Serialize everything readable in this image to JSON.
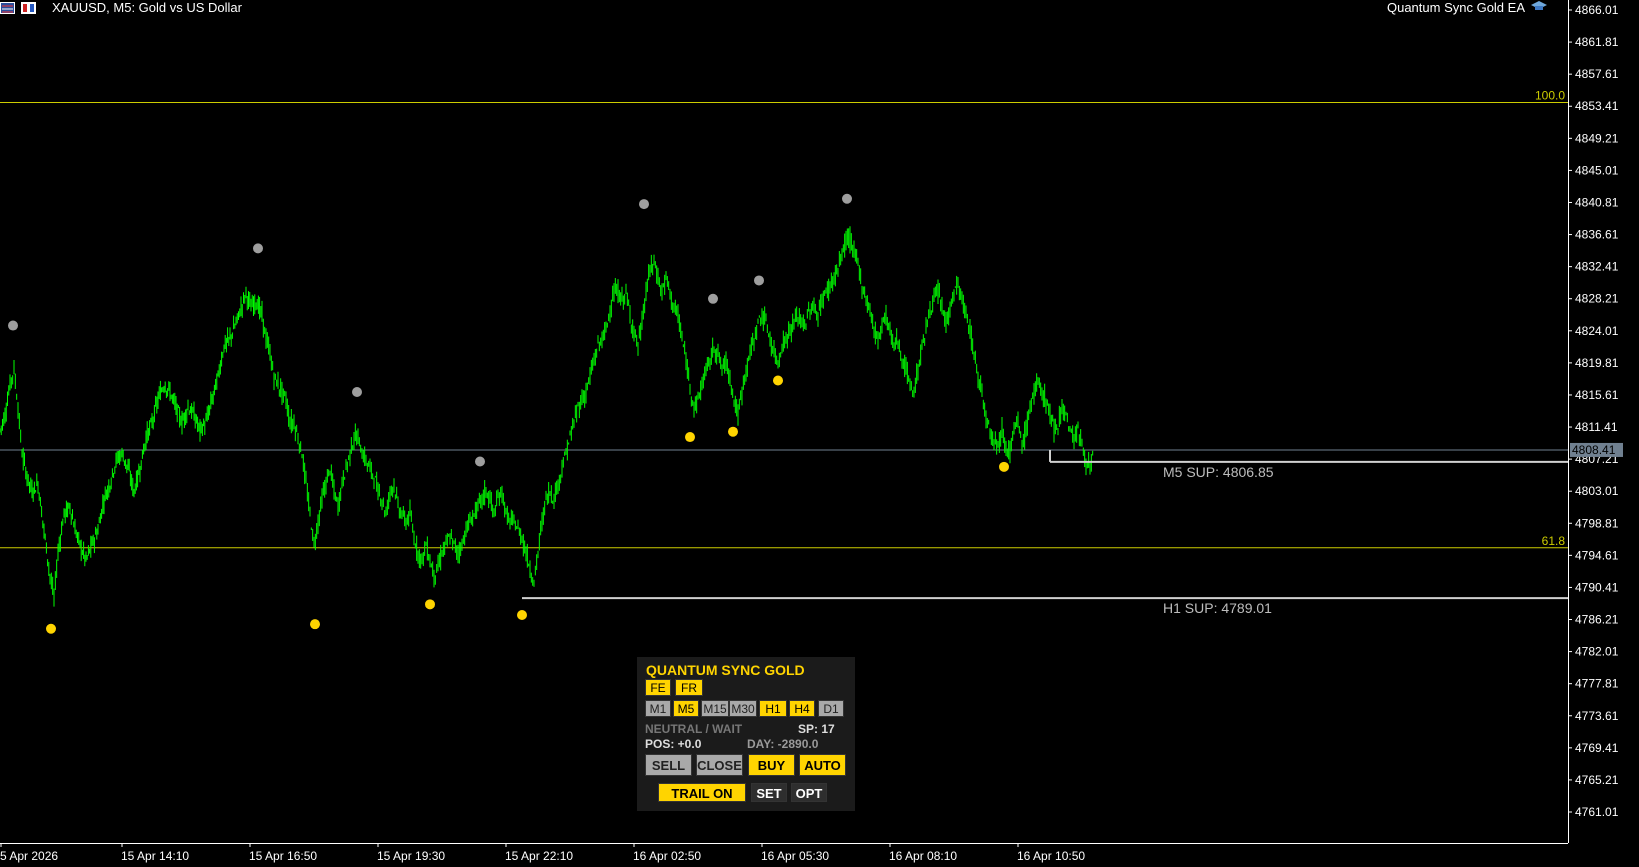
{
  "chart_data": {
    "type": "candlestick",
    "title": "XAUUSD, M5:  Gold vs US Dollar",
    "ylim": [
      4757.5,
      4867.0
    ],
    "yticks": [
      "4866.01",
      "4861.81",
      "4857.61",
      "4853.41",
      "4849.21",
      "4845.01",
      "4840.81",
      "4836.61",
      "4832.41",
      "4828.21",
      "4824.01",
      "4819.81",
      "4815.61",
      "4811.41",
      "4807.21",
      "4803.01",
      "4798.81",
      "4794.61",
      "4790.41",
      "4786.21",
      "4782.01",
      "4777.81",
      "4773.61",
      "4769.41",
      "4765.21",
      "4761.01"
    ],
    "xticks": [
      "5 Apr 2026",
      "15 Apr 14:10",
      "15 Apr 16:50",
      "15 Apr 19:30",
      "15 Apr 22:10",
      "16 Apr 02:50",
      "16 Apr 05:30",
      "16 Apr 08:10",
      "16 Apr 10:50"
    ],
    "current_price": "4808.41",
    "path": [
      [
        0,
        4811
      ],
      [
        5,
        4813
      ],
      [
        10,
        4817
      ],
      [
        14,
        4819
      ],
      [
        18,
        4814
      ],
      [
        22,
        4808
      ],
      [
        27,
        4805
      ],
      [
        32,
        4803
      ],
      [
        38,
        4804
      ],
      [
        44,
        4798
      ],
      [
        50,
        4792
      ],
      [
        54,
        4789
      ],
      [
        58,
        4795
      ],
      [
        64,
        4800
      ],
      [
        70,
        4801
      ],
      [
        75,
        4798
      ],
      [
        80,
        4796
      ],
      [
        86,
        4794
      ],
      [
        92,
        4796
      ],
      [
        98,
        4798
      ],
      [
        104,
        4802
      ],
      [
        110,
        4804
      ],
      [
        116,
        4807
      ],
      [
        122,
        4808
      ],
      [
        128,
        4806
      ],
      [
        134,
        4803
      ],
      [
        140,
        4806
      ],
      [
        146,
        4810
      ],
      [
        152,
        4812
      ],
      [
        158,
        4815
      ],
      [
        164,
        4817
      ],
      [
        170,
        4816
      ],
      [
        176,
        4814
      ],
      [
        182,
        4812
      ],
      [
        188,
        4814
      ],
      [
        194,
        4813
      ],
      [
        200,
        4811
      ],
      [
        206,
        4812
      ],
      [
        212,
        4815
      ],
      [
        218,
        4818
      ],
      [
        224,
        4822
      ],
      [
        230,
        4823
      ],
      [
        236,
        4825
      ],
      [
        241,
        4827
      ],
      [
        246,
        4829
      ],
      [
        251,
        4827
      ],
      [
        256,
        4828
      ],
      [
        262,
        4826
      ],
      [
        266,
        4823
      ],
      [
        270,
        4821
      ],
      [
        274,
        4818
      ],
      [
        278,
        4817
      ],
      [
        282,
        4816
      ],
      [
        286,
        4815
      ],
      [
        290,
        4812
      ],
      [
        294,
        4812
      ],
      [
        298,
        4810
      ],
      [
        302,
        4808
      ],
      [
        306,
        4804
      ],
      [
        310,
        4800
      ],
      [
        314,
        4796
      ],
      [
        318,
        4799
      ],
      [
        322,
        4802
      ],
      [
        326,
        4804
      ],
      [
        330,
        4806
      ],
      [
        334,
        4803
      ],
      [
        338,
        4801
      ],
      [
        342,
        4804
      ],
      [
        346,
        4806
      ],
      [
        350,
        4808
      ],
      [
        354,
        4810
      ],
      [
        358,
        4810
      ],
      [
        362,
        4808
      ],
      [
        366,
        4807
      ],
      [
        370,
        4806
      ],
      [
        374,
        4805
      ],
      [
        378,
        4803
      ],
      [
        382,
        4802
      ],
      [
        386,
        4800
      ],
      [
        390,
        4803
      ],
      [
        394,
        4804
      ],
      [
        398,
        4801
      ],
      [
        402,
        4800
      ],
      [
        406,
        4799
      ],
      [
        410,
        4800
      ],
      [
        414,
        4797
      ],
      [
        418,
        4795
      ],
      [
        422,
        4794
      ],
      [
        426,
        4796
      ],
      [
        430,
        4794
      ],
      [
        434,
        4792
      ],
      [
        438,
        4793
      ],
      [
        442,
        4795
      ],
      [
        446,
        4796
      ],
      [
        450,
        4797
      ],
      [
        454,
        4796
      ],
      [
        458,
        4795
      ],
      [
        462,
        4796
      ],
      [
        466,
        4798
      ],
      [
        470,
        4799
      ],
      [
        474,
        4800
      ],
      [
        478,
        4801
      ],
      [
        482,
        4802
      ],
      [
        486,
        4803
      ],
      [
        490,
        4802
      ],
      [
        494,
        4800
      ],
      [
        498,
        4802
      ],
      [
        502,
        4803
      ],
      [
        506,
        4800
      ],
      [
        510,
        4799
      ],
      [
        514,
        4799
      ],
      [
        518,
        4798
      ],
      [
        522,
        4797
      ],
      [
        526,
        4795
      ],
      [
        530,
        4793
      ],
      [
        534,
        4791
      ],
      [
        538,
        4795
      ],
      [
        542,
        4799
      ],
      [
        546,
        4802
      ],
      [
        550,
        4803
      ],
      [
        554,
        4802
      ],
      [
        558,
        4804
      ],
      [
        562,
        4806
      ],
      [
        566,
        4808
      ],
      [
        570,
        4810
      ],
      [
        574,
        4812
      ],
      [
        578,
        4814
      ],
      [
        582,
        4815
      ],
      [
        586,
        4816
      ],
      [
        590,
        4818
      ],
      [
        594,
        4820
      ],
      [
        598,
        4822
      ],
      [
        602,
        4823
      ],
      [
        606,
        4824
      ],
      [
        610,
        4827
      ],
      [
        614,
        4829
      ],
      [
        618,
        4829
      ],
      [
        622,
        4828
      ],
      [
        626,
        4829
      ],
      [
        630,
        4826
      ],
      [
        634,
        4824
      ],
      [
        638,
        4822
      ],
      [
        642,
        4825
      ],
      [
        646,
        4829
      ],
      [
        650,
        4832
      ],
      [
        654,
        4833
      ],
      [
        658,
        4831
      ],
      [
        662,
        4829
      ],
      [
        666,
        4831
      ],
      [
        670,
        4829
      ],
      [
        674,
        4827
      ],
      [
        678,
        4826
      ],
      [
        682,
        4823
      ],
      [
        686,
        4820
      ],
      [
        690,
        4817
      ],
      [
        694,
        4814
      ],
      [
        698,
        4815
      ],
      [
        702,
        4817
      ],
      [
        706,
        4819
      ],
      [
        710,
        4820
      ],
      [
        714,
        4822
      ],
      [
        718,
        4821
      ],
      [
        722,
        4819
      ],
      [
        726,
        4820
      ],
      [
        730,
        4818
      ],
      [
        734,
        4815
      ],
      [
        738,
        4813
      ],
      [
        742,
        4816
      ],
      [
        746,
        4819
      ],
      [
        750,
        4821
      ],
      [
        754,
        4823
      ],
      [
        758,
        4825
      ],
      [
        762,
        4826
      ],
      [
        766,
        4825
      ],
      [
        770,
        4823
      ],
      [
        774,
        4821
      ],
      [
        778,
        4820
      ],
      [
        782,
        4822
      ],
      [
        786,
        4823
      ],
      [
        790,
        4824
      ],
      [
        794,
        4825
      ],
      [
        798,
        4826
      ],
      [
        802,
        4825
      ],
      [
        806,
        4825
      ],
      [
        810,
        4827
      ],
      [
        814,
        4827
      ],
      [
        818,
        4826
      ],
      [
        822,
        4828
      ],
      [
        826,
        4829
      ],
      [
        830,
        4830
      ],
      [
        834,
        4831
      ],
      [
        838,
        4832
      ],
      [
        842,
        4834
      ],
      [
        846,
        4836
      ],
      [
        850,
        4836
      ],
      [
        854,
        4834
      ],
      [
        858,
        4833
      ],
      [
        862,
        4830
      ],
      [
        866,
        4828
      ],
      [
        870,
        4827
      ],
      [
        874,
        4824
      ],
      [
        878,
        4823
      ],
      [
        882,
        4825
      ],
      [
        886,
        4826
      ],
      [
        890,
        4824
      ],
      [
        894,
        4822
      ],
      [
        898,
        4823
      ],
      [
        902,
        4820
      ],
      [
        906,
        4819
      ],
      [
        910,
        4817
      ],
      [
        914,
        4816
      ],
      [
        918,
        4819
      ],
      [
        922,
        4822
      ],
      [
        926,
        4824
      ],
      [
        930,
        4827
      ],
      [
        934,
        4828
      ],
      [
        938,
        4829
      ],
      [
        942,
        4827
      ],
      [
        946,
        4825
      ],
      [
        950,
        4827
      ],
      [
        954,
        4829
      ],
      [
        958,
        4830
      ],
      [
        962,
        4828
      ],
      [
        966,
        4826
      ],
      [
        970,
        4824
      ],
      [
        974,
        4821
      ],
      [
        978,
        4818
      ],
      [
        982,
        4816
      ],
      [
        986,
        4813
      ],
      [
        990,
        4811
      ],
      [
        994,
        4810
      ],
      [
        998,
        4809
      ],
      [
        1002,
        4811
      ],
      [
        1006,
        4809
      ],
      [
        1010,
        4808
      ],
      [
        1014,
        4811
      ],
      [
        1018,
        4812
      ],
      [
        1022,
        4809
      ],
      [
        1026,
        4811
      ],
      [
        1030,
        4814
      ],
      [
        1034,
        4816
      ],
      [
        1038,
        4817
      ],
      [
        1042,
        4816
      ],
      [
        1046,
        4815
      ],
      [
        1050,
        4813
      ],
      [
        1054,
        4811
      ],
      [
        1058,
        4812
      ],
      [
        1062,
        4814
      ],
      [
        1066,
        4813
      ],
      [
        1070,
        4811
      ],
      [
        1074,
        4810
      ],
      [
        1078,
        4811
      ],
      [
        1082,
        4809
      ],
      [
        1086,
        4807
      ],
      [
        1090,
        4806
      ],
      [
        1094,
        4808
      ]
    ],
    "swing_highs": [
      [
        13,
        4824.7
      ],
      [
        258,
        4834.8
      ],
      [
        357,
        4816.0
      ],
      [
        480,
        4806.9
      ],
      [
        644,
        4840.6
      ],
      [
        713,
        4828.2
      ],
      [
        759,
        4830.6
      ],
      [
        847,
        4841.3
      ]
    ],
    "swing_lows": [
      [
        51,
        4785.0
      ],
      [
        315,
        4785.6
      ],
      [
        430,
        4788.2
      ],
      [
        522,
        4786.8
      ],
      [
        690,
        4810.1
      ],
      [
        733,
        4810.8
      ],
      [
        778,
        4817.5
      ],
      [
        1004,
        4806.2
      ]
    ],
    "fib_levels": [
      {
        "label": "100.0",
        "price": 4853.9
      },
      {
        "label": "61.8",
        "price": 4795.6
      }
    ],
    "support_levels": [
      {
        "label": "M5 SUP: 4806.85",
        "price": 4806.85,
        "from_x": 1050
      },
      {
        "label": "H1 SUP: 4789.01",
        "price": 4789.01,
        "from_x": 522
      }
    ],
    "grid": false
  },
  "header": {
    "symbol_title": "XAUUSD, M5:  Gold vs US Dollar",
    "ea_name": "Quantum Sync Gold EA"
  },
  "panel": {
    "title": "QUANTUM SYNC GOLD",
    "lang": [
      "FE",
      "FR"
    ],
    "timeframes": [
      {
        "label": "M1",
        "active": false
      },
      {
        "label": "M5",
        "active": true
      },
      {
        "label": "M15",
        "active": false
      },
      {
        "label": "M30",
        "active": false
      },
      {
        "label": "H1",
        "active": true
      },
      {
        "label": "H4",
        "active": true
      },
      {
        "label": "D1",
        "active": false
      }
    ],
    "status": "NEUTRAL / WAIT",
    "spread": "SP: 17",
    "pos": "POS: +0.0",
    "day": "DAY: -2890.0",
    "buttons": {
      "sell": "SELL",
      "close": "CLOSE",
      "buy": "BUY",
      "auto": "AUTO",
      "trail": "TRAIL ON",
      "set": "SET",
      "opt": "OPT"
    }
  },
  "colors": {
    "candle": "#00ff00",
    "fib": "#cccc00",
    "dot_high": "#9e9e9e",
    "dot_low": "#ffd400",
    "support": "#d0d0d0",
    "price_line": "#708090",
    "axis": "#ffffff",
    "panel_accent": "#ffd400"
  }
}
